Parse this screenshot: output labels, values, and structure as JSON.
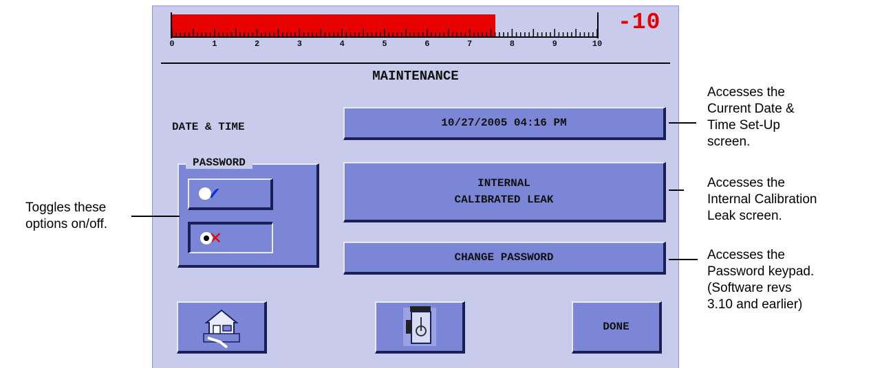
{
  "gauge": {
    "value": 7.6,
    "max": 10,
    "tick_labels": [
      "0",
      "1",
      "2",
      "3",
      "4",
      "5",
      "6",
      "7",
      "8",
      "9",
      "10"
    ],
    "readout": "-10",
    "fill_color": "#e60000"
  },
  "screen": {
    "title": "MAINTENANCE",
    "date_time_label": "DATE & TIME",
    "date_time_value": "10/27/2005 04:16 PM",
    "internal_leak_line1": "INTERNAL",
    "internal_leak_line2": "CALIBRATED LEAK",
    "change_password_label": "CHANGE PASSWORD",
    "password_label": "PASSWORD",
    "password_on_symbol": "✔",
    "password_off_symbol": "✕",
    "password_selected": "off",
    "done_label": "DONE",
    "home_icon": "home-icon",
    "service_icon": "service-icon"
  },
  "callouts": {
    "toggle_line1": "Toggles these",
    "toggle_line2": "options on/off.",
    "date_line1": "Accesses the",
    "date_line2": "Current Date &",
    "date_line3": "Time Set-Up",
    "date_line4": "screen.",
    "leak_line1": "Accesses the",
    "leak_line2": "Internal Calibration",
    "leak_line3": "Leak screen.",
    "pw_line1": "Accesses the",
    "pw_line2": "Password keypad.",
    "pw_line3": "(Software revs",
    "pw_line4": "3.10 and earlier)"
  },
  "colors": {
    "screen_bg": "#c8cbec",
    "button": "#7b86d6",
    "readout": "#e60000",
    "check": "#1030d0",
    "cross": "#e60000"
  }
}
